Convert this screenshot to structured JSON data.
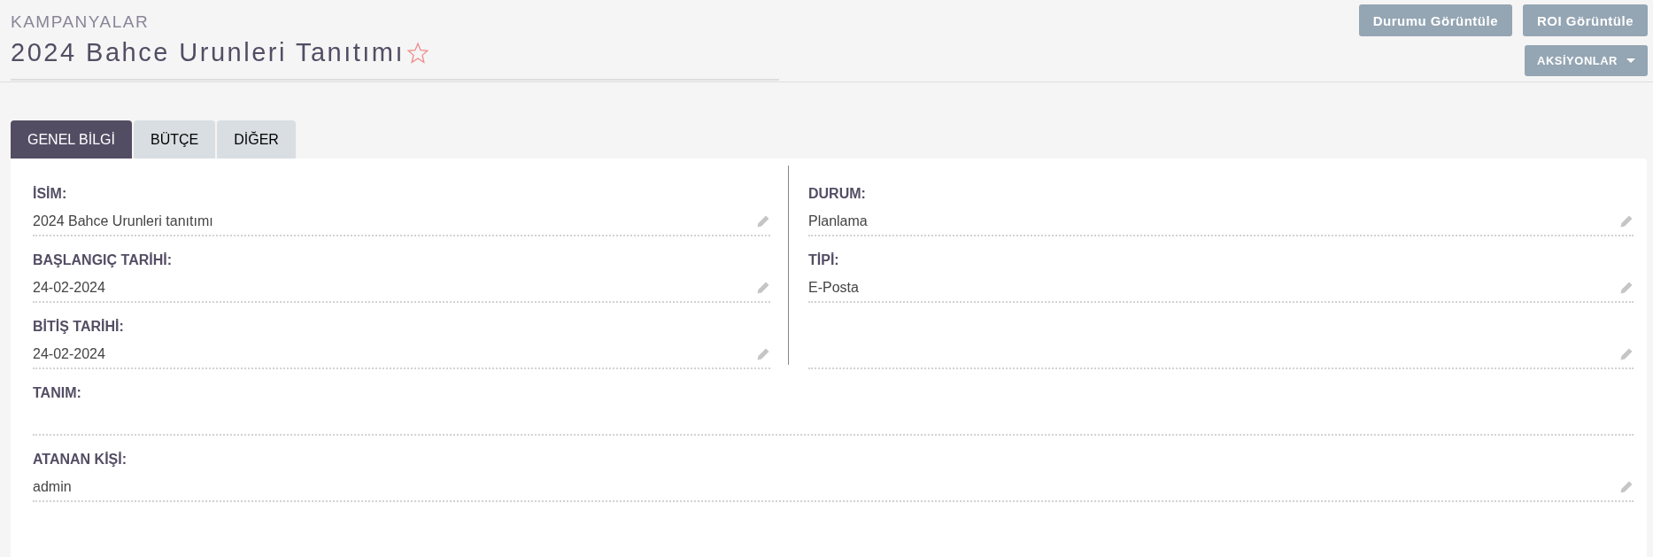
{
  "header": {
    "module": "KAMPANYALAR",
    "title": "2024 Bahce Urunleri Tanıtımı",
    "favorite": false
  },
  "buttons": [
    {
      "label": "Durumu Görüntüle"
    },
    {
      "label": "ROI Görüntüle"
    }
  ],
  "actions_menu": {
    "label": "AKSİYONLAR"
  },
  "tabs": [
    {
      "label": "GENEL BİLGİ",
      "selected": true
    },
    {
      "label": "BÜTÇE",
      "selected": false
    },
    {
      "label": "DİĞER",
      "selected": false
    }
  ],
  "left_fields": [
    {
      "kind": "field",
      "label": "İSİM:",
      "value": "2024 Bahce Urunleri tanıtımı",
      "editable": true
    },
    {
      "kind": "field",
      "label": "BAŞLANGIÇ TARİHİ:",
      "value": "24-02-2024",
      "editable": true
    },
    {
      "kind": "field",
      "label": "BİTİŞ TARİHİ:",
      "value": "24-02-2024",
      "editable": true
    }
  ],
  "right_fields": [
    {
      "kind": "field",
      "label": "DURUM:",
      "value": "Planlama",
      "editable": true
    },
    {
      "kind": "field",
      "label": "TİPİ:",
      "value": "E-Posta",
      "editable": true
    },
    {
      "kind": "empty",
      "editable": true
    }
  ],
  "wide_fields": [
    {
      "kind": "field",
      "label": "TANIM:",
      "editable": false
    },
    {
      "kind": "field",
      "label": "ATANAN KİŞİ:",
      "value": "admin",
      "editable": true
    }
  ]
}
